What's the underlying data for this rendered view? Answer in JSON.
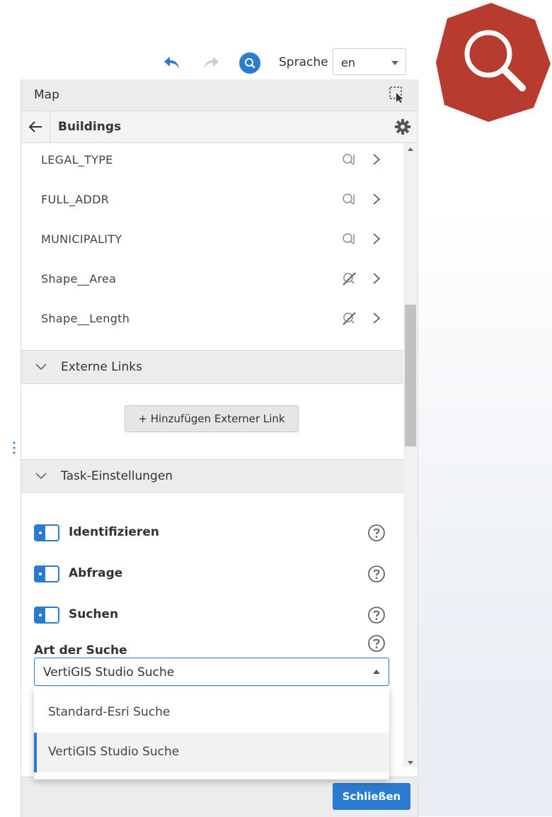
{
  "toolbar": {
    "undo_icon": "undo-icon",
    "redo_icon": "redo-icon",
    "search_icon": "search-icon",
    "language_label": "Sprache",
    "language_value": "en"
  },
  "logo": {
    "icon": "search-icon",
    "color": "#b83b2f"
  },
  "panel": {
    "title": "Map",
    "subtitle": "Buildings"
  },
  "fields": [
    {
      "name": "LEGAL_TYPE",
      "icon": "query-icon"
    },
    {
      "name": "FULL_ADDR",
      "icon": "query-icon"
    },
    {
      "name": "MUNICIPALITY",
      "icon": "query-icon"
    },
    {
      "name": "Shape__Area",
      "icon": "query-disabled-icon"
    },
    {
      "name": "Shape__Length",
      "icon": "query-disabled-icon"
    }
  ],
  "external_links": {
    "title": "Externe Links",
    "add_button": "+ Hinzufügen Externer Link"
  },
  "task_settings": {
    "title": "Task-Einstellungen",
    "toggles": [
      {
        "label": "Identifizieren",
        "enabled": true
      },
      {
        "label": "Abfrage",
        "enabled": true
      },
      {
        "label": "Suchen",
        "enabled": true
      }
    ],
    "search_type_label": "Art der Suche",
    "search_type_value": "VertiGIS Studio Suche"
  },
  "dropdown": {
    "options": [
      "Standard-Esri Suche",
      "VertiGIS Studio Suche"
    ],
    "selected": "VertiGIS Studio Suche"
  },
  "footer": {
    "close_label": "Schließen"
  },
  "colors": {
    "accent": "#2b7bd0",
    "logo": "#b83b2f"
  }
}
